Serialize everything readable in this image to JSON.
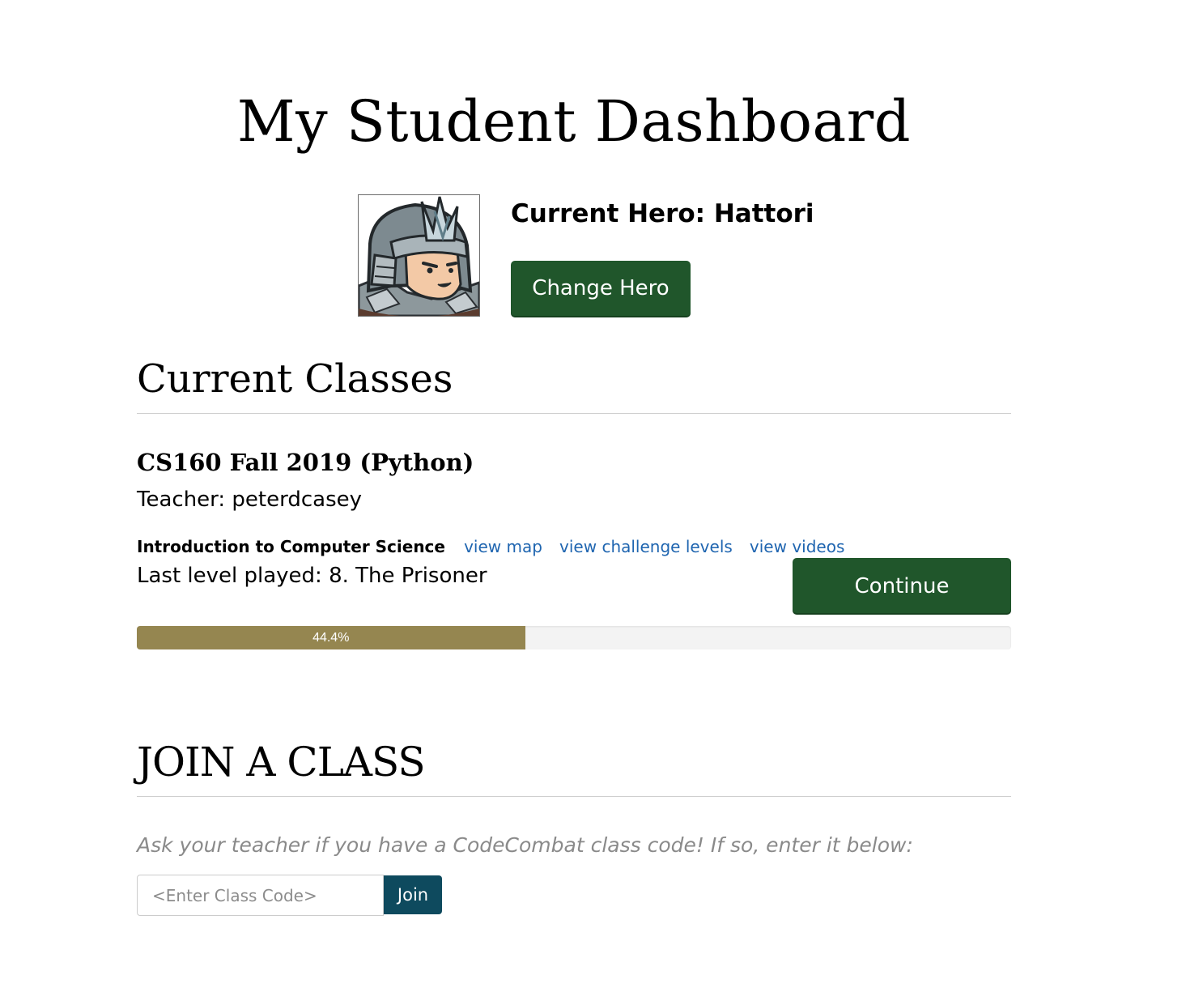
{
  "page": {
    "title": "My Student Dashboard"
  },
  "hero": {
    "name_label": "Current Hero: Hattori",
    "portrait_icon": "hattori-hero-portrait-icon",
    "change_button": "Change Hero"
  },
  "current_classes": {
    "heading": "Current Classes",
    "classes": [
      {
        "name": "CS160 Fall 2019 (Python)",
        "teacher": "Teacher: peterdcasey",
        "course": "Introduction to Computer Science",
        "links": [
          "view map",
          "view challenge levels",
          "view videos"
        ],
        "last_level": "Last level played: 8. The Prisoner",
        "continue_button": "Continue",
        "progress_fraction": 0.444,
        "progress_label": "44.4%"
      }
    ]
  },
  "join_class": {
    "heading": "JOIN A CLASS",
    "hint": "Ask your teacher if you have a CodeCombat class code! If so, enter it below:",
    "input_placeholder": "<Enter Class Code>",
    "input_value": "",
    "join_button": "Join"
  },
  "colors": {
    "primary_green": "#20562b",
    "progress_fill": "#958650",
    "join_button": "#0e4a5e",
    "link_blue": "#1f65b0"
  }
}
